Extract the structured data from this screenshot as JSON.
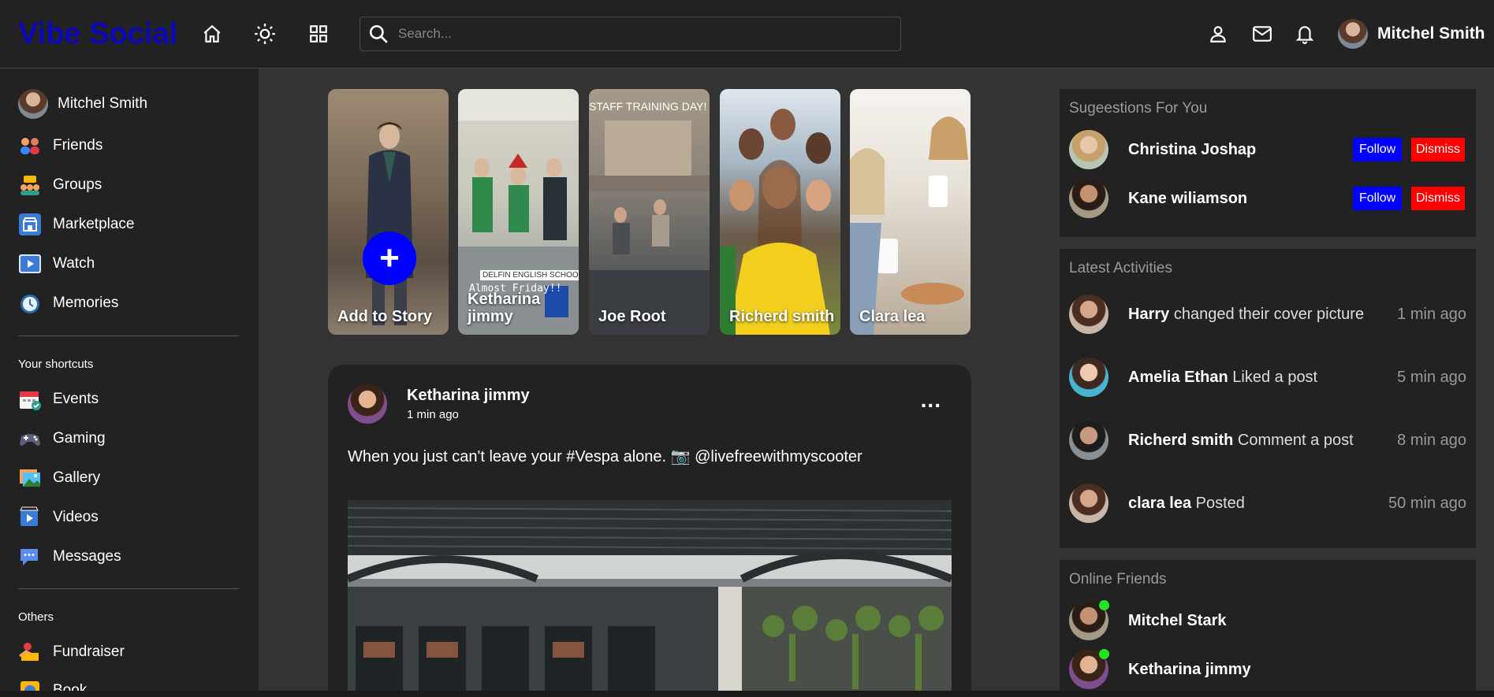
{
  "app": {
    "logo": "Vibe Social"
  },
  "topbar": {
    "icons": [
      "home-icon",
      "sun-icon",
      "grid-icon"
    ],
    "search_placeholder": "Search...",
    "right_icons": [
      "person-icon",
      "mail-icon",
      "bell-icon"
    ],
    "user_name": "Mitchel Smith"
  },
  "sidebar": {
    "user_name": "Mitchel Smith",
    "items": [
      {
        "label": "Friends",
        "icon": "friends-icon"
      },
      {
        "label": "Groups",
        "icon": "groups-icon"
      },
      {
        "label": "Marketplace",
        "icon": "marketplace-icon"
      },
      {
        "label": "Watch",
        "icon": "watch-icon"
      },
      {
        "label": "Memories",
        "icon": "memories-icon"
      }
    ],
    "shortcuts_heading": "Your shortcuts",
    "shortcuts": [
      {
        "label": "Events",
        "icon": "events-icon"
      },
      {
        "label": "Gaming",
        "icon": "gaming-icon"
      },
      {
        "label": "Gallery",
        "icon": "gallery-icon"
      },
      {
        "label": "Videos",
        "icon": "videos-icon"
      },
      {
        "label": "Messages",
        "icon": "messages-icon"
      }
    ],
    "others_heading": "Others",
    "others": [
      {
        "label": "Fundraiser",
        "icon": "fundraiser-icon"
      },
      {
        "label": "Book",
        "icon": "book-icon"
      }
    ]
  },
  "stories": [
    {
      "name": "Add to Story",
      "add": "+"
    },
    {
      "name": "Ketharina jimmy",
      "overlay": "DELFIN ENGLISH SCHOOL",
      "overlay2": "Almost Friday!!"
    },
    {
      "name": "Joe Root",
      "overlay": "STAFF TRAINING DAY!"
    },
    {
      "name": "Richerd smith"
    },
    {
      "name": "Clara lea"
    }
  ],
  "post": {
    "author": "Ketharina jimmy",
    "time": "1 min ago",
    "more": "...",
    "text": "When you just can't leave your #Vespa alone. 📷 @livefreewithmyscooter"
  },
  "suggestions": {
    "title": "Sugeestions For You",
    "follow_label": "Follow",
    "dismiss_label": "Dismiss",
    "people": [
      {
        "name": "Christina Joshap"
      },
      {
        "name": "Kane wiliamson"
      }
    ]
  },
  "activities": {
    "title": "Latest Activities",
    "items": [
      {
        "name": "Harry",
        "action": "changed their cover picture",
        "time": "1 min ago"
      },
      {
        "name": "Amelia Ethan",
        "action": "Liked a post",
        "time": "5 min ago"
      },
      {
        "name": "Richerd smith",
        "action": "Comment a post",
        "time": "8 min ago"
      },
      {
        "name": "clara lea",
        "action": "Posted",
        "time": "50 min ago"
      }
    ]
  },
  "online": {
    "title": "Online Friends",
    "friends": [
      {
        "name": "Mitchel Stark"
      },
      {
        "name": "Ketharina jimmy"
      }
    ]
  },
  "colors": {
    "logo": "#0a08b8",
    "follow": "#0000ff",
    "dismiss": "#ff0000",
    "online": "#22e522",
    "background": "#333333",
    "panel": "#222222"
  }
}
